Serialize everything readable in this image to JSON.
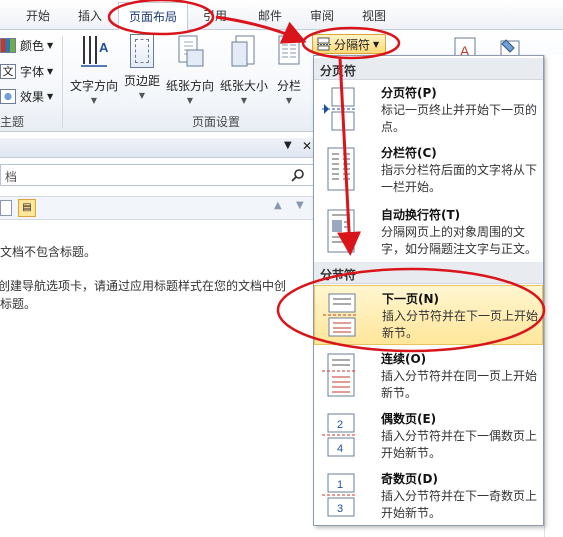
{
  "tabs": [
    {
      "label": "开始",
      "active": false
    },
    {
      "label": "插入",
      "active": false
    },
    {
      "label": "页面布局",
      "active": true
    },
    {
      "label": "引用",
      "active": false
    },
    {
      "label": "邮件",
      "active": false
    },
    {
      "label": "审阅",
      "active": false
    },
    {
      "label": "视图",
      "active": false
    }
  ],
  "ribbon": {
    "theme_colors": "颜色",
    "theme_fonts": "字体",
    "theme_effects": "效果",
    "group_themes": "主题",
    "group_page_setup": "页面设置",
    "text_direction": "文字方向",
    "margins": "页边距",
    "orientation": "纸张方向",
    "size": "纸张大小",
    "columns": "分栏",
    "breaks": "分隔符",
    "page_bg_partial": "页面"
  },
  "nav_pane": {
    "search_value": "档",
    "line1": "文档不包含标题。",
    "line2": "创建导航选项卡，请通过应用标题样式在您的文档中创",
    "line3": "标题。"
  },
  "dropdown": {
    "section_page_breaks": "分页符",
    "section_section_breaks": "分节符",
    "page_break": {
      "title": "分页符(P)",
      "desc": "标记一页终止并开始下一页的点。"
    },
    "column_break": {
      "title": "分栏符(C)",
      "desc": "指示分栏符后面的文字将从下一栏开始。"
    },
    "text_wrapping": {
      "title": "自动换行符(T)",
      "desc": "分隔网页上的对象周围的文字，如分隔题注文字与正文。"
    },
    "next_page": {
      "title": "下一页(N)",
      "desc": "插入分节符并在下一页上开始新节。"
    },
    "continuous": {
      "title": "连续(O)",
      "desc": "插入分节符并在同一页上开始新节。"
    },
    "even_page": {
      "title": "偶数页(E)",
      "desc": "插入分节符并在下一偶数页上开始新节。"
    },
    "odd_page": {
      "title": "奇数页(D)",
      "desc": "插入分节符并在下一奇数页上开始新节。"
    }
  },
  "colors": {
    "annotation": "#d9141a",
    "highlight": "#ffe69a"
  }
}
